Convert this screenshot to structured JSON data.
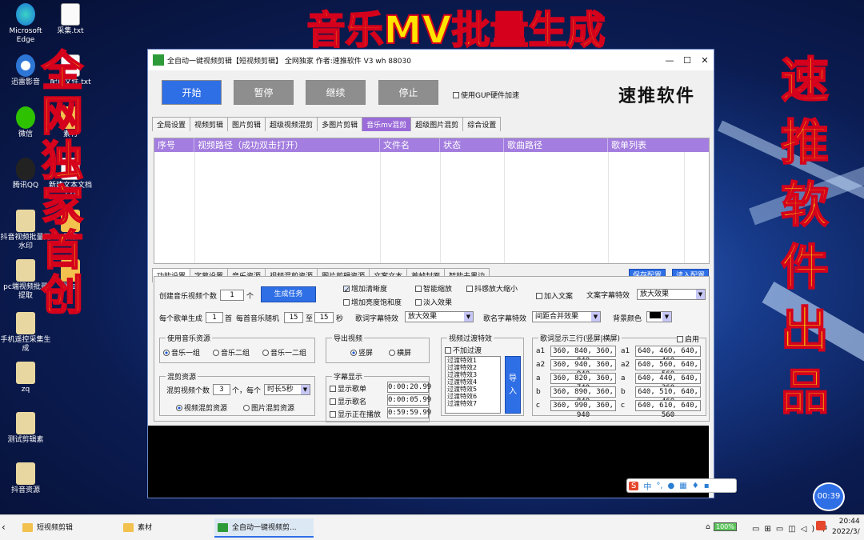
{
  "overlay": {
    "top_banner": "音乐MV批量生成",
    "left_vertical": [
      "全",
      "网",
      "独",
      "家",
      "首",
      "创"
    ],
    "right_vertical": [
      "速",
      "推",
      "软",
      "件",
      "出",
      "品"
    ]
  },
  "desktop_icons": [
    {
      "label": "Microsoft Edge",
      "icon": "edge-icon"
    },
    {
      "label": "采集.txt",
      "icon": "text-file-icon"
    },
    {
      "label": "迅雷影音",
      "icon": "media-player-icon"
    },
    {
      "label": "配置文件.txt",
      "icon": "text-file-icon"
    },
    {
      "label": "微信",
      "icon": "wechat-icon"
    },
    {
      "label": "素材",
      "icon": "folder-icon"
    },
    {
      "label": "腾讯QQ",
      "icon": "qq-icon"
    },
    {
      "label": "新建文本文档(2)",
      "icon": "text-file-icon"
    },
    {
      "label": "抖音视频批量无水印",
      "icon": "folder-icon"
    },
    {
      "label": "采集",
      "icon": "folder-icon"
    },
    {
      "label": "pc端视频批量提取",
      "icon": "folder-icon"
    },
    {
      "label": "测试",
      "icon": "folder-icon"
    },
    {
      "label": "手机遥控采集生成",
      "icon": "folder-icon"
    },
    {
      "label": "zq",
      "icon": "folder-icon"
    },
    {
      "label": "测试剪辑素",
      "icon": "folder-icon"
    },
    {
      "label": "抖音资源",
      "icon": "folder-icon"
    }
  ],
  "window": {
    "title": "全自动一键视频剪辑【短视频剪辑】  全网独家 作者:速推软件  V3  wh 88030",
    "brand": "速推软件",
    "buttons": {
      "start": "开始",
      "pause": "暂停",
      "resume": "继续",
      "stop": "停止"
    },
    "gpu_label": "使用GUP硬件加速",
    "top_tabs": [
      "全局设置",
      "视频剪辑",
      "图片剪辑",
      "超级视频混剪",
      "多图片剪辑",
      "音乐mv混剪",
      "超级图片混剪",
      "综合设置"
    ],
    "active_top_tab": "音乐mv混剪",
    "table_headers": [
      "序号",
      "视频路径（成功双击打开）",
      "文件名",
      "状态",
      "歌曲路径",
      "歌单列表"
    ],
    "sub_tabs": [
      "功能设置",
      "字幕设置",
      "音乐资源",
      "视频混剪资源",
      "图片剪辑资源",
      "文案文本",
      "首帧封面",
      "智能去黑边"
    ],
    "save_config": "保存配置",
    "load_config": "读入配置",
    "settings": {
      "create_count_label": "创建音乐视频个数",
      "create_count": "1",
      "create_unit": "个",
      "generate_task": "生成任务",
      "per_playlist_label": "每个歌单生成",
      "per_playlist": "1",
      "per_playlist_unit": "首",
      "random_label": "每首音乐随机",
      "random_from": "15",
      "random_to_label": "至",
      "random_to": "15",
      "random_unit": "秒",
      "add_sharpness": "增加清晰度",
      "add_brightness": "增加亮度饱和度",
      "smart_zoom": "智能缩放",
      "fade_in": "淡入效果",
      "jitter_zoom": "抖感放大缩小",
      "add_copy": "加入文案",
      "copy_effect_label": "文案字幕特效",
      "copy_effect": "放大效果",
      "lyric_effect_label": "歌词字幕特效",
      "lyric_effect": "放大效果",
      "singer_effect_label": "歌名字幕特效",
      "singer_effect": "间距合并效果",
      "bg_color_label": "背景颜色"
    },
    "music_group": {
      "title": "使用音乐资源",
      "options": [
        "音乐一组",
        "音乐二组",
        "音乐一二组"
      ],
      "selected": 0
    },
    "export_group": {
      "title": "导出视频",
      "options": [
        "竖屏",
        "横屏"
      ],
      "selected": 0
    },
    "mix_group": {
      "title": "混剪资源",
      "count_label": "混剪视频个数",
      "count": "3",
      "each_label": "个，每个",
      "duration": "时长5秒",
      "options": [
        "视频混剪资源",
        "图片混剪资源"
      ],
      "selected": 0
    },
    "subtitle_group": {
      "title": "字幕显示",
      "rows": [
        {
          "label": "显示歌单",
          "time": "0:00:20.99"
        },
        {
          "label": "显示歌名",
          "time": "0:00:05.99"
        },
        {
          "label": "显示正在播放",
          "time": "0:59:59.99"
        }
      ]
    },
    "transition_group": {
      "title": "视频过渡特效",
      "no_transition": "不加过渡",
      "items": [
        "过渡特效1",
        "过渡特效2",
        "过渡特效3",
        "过渡特效4",
        "过渡特效5",
        "过渡特效6",
        "过渡特效7"
      ],
      "import_btn": "导入"
    },
    "lyric_group": {
      "title": "歌词显示三行(竖屏|横屏)",
      "enable": "启用",
      "left": [
        {
          "label": "a1",
          "value": "360, 840, 360, 840"
        },
        {
          "label": "a2",
          "value": "360, 940, 360, 940"
        },
        {
          "label": "a",
          "value": "360, 820, 360, 740"
        },
        {
          "label": "b",
          "value": "360, 890, 360, 840"
        },
        {
          "label": "c",
          "value": "360, 990, 360, 940"
        }
      ],
      "right": [
        {
          "label": "a1",
          "value": "640, 460, 640, 460"
        },
        {
          "label": "a2",
          "value": "640, 560, 640, 560"
        },
        {
          "label": "a",
          "value": "640, 440, 640, 360"
        },
        {
          "label": "b",
          "value": "640, 510, 640, 460"
        },
        {
          "label": "c",
          "value": "640, 610, 640, 560"
        }
      ]
    }
  },
  "timer": "00:39",
  "taskbar": {
    "items": [
      "短视频剪辑",
      "素材",
      "全自动一键视频剪..."
    ],
    "battery": "100%",
    "time": "20:44",
    "date": "2022/3/"
  },
  "ime_label": "中"
}
